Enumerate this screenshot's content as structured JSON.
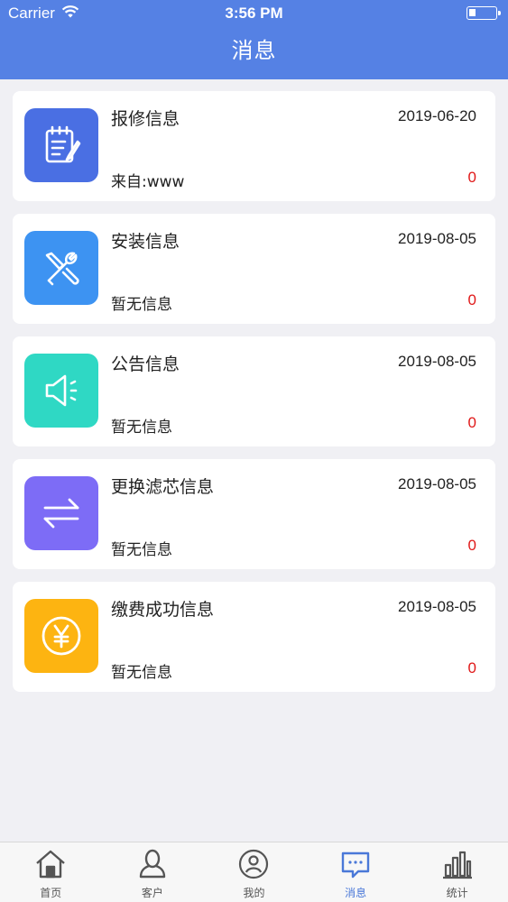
{
  "status_bar": {
    "carrier": "Carrier",
    "time": "3:56 PM"
  },
  "nav": {
    "title": "消息"
  },
  "messages": [
    {
      "title": "报修信息",
      "date": "2019-06-20",
      "from": "来自:www",
      "count": "0",
      "icon": "clipboard-edit-icon",
      "color": "#4a6fe3"
    },
    {
      "title": "安装信息",
      "date": "2019-08-05",
      "from": "暂无信息",
      "count": "0",
      "icon": "tools-icon",
      "color": "#3d93f2"
    },
    {
      "title": "公告信息",
      "date": "2019-08-05",
      "from": "暂无信息",
      "count": "0",
      "icon": "speaker-icon",
      "color": "#2fd8c4"
    },
    {
      "title": "更换滤芯信息",
      "date": "2019-08-05",
      "from": "暂无信息",
      "count": "0",
      "icon": "swap-arrows-icon",
      "color": "#7d6cf6"
    },
    {
      "title": "缴费成功信息",
      "date": "2019-08-05",
      "from": "暂无信息",
      "count": "0",
      "icon": "yen-coin-icon",
      "color": "#fdb411"
    }
  ],
  "tabbar": {
    "tabs": [
      {
        "label": "首页",
        "icon": "home-icon"
      },
      {
        "label": "客户",
        "icon": "customer-icon"
      },
      {
        "label": "我的",
        "icon": "profile-icon"
      },
      {
        "label": "消息",
        "icon": "message-icon",
        "active": true
      },
      {
        "label": "统计",
        "icon": "statistics-icon"
      }
    ]
  },
  "colors": {
    "header": "#5581e4",
    "accent": "#4a78d8",
    "count": "#e01818"
  }
}
